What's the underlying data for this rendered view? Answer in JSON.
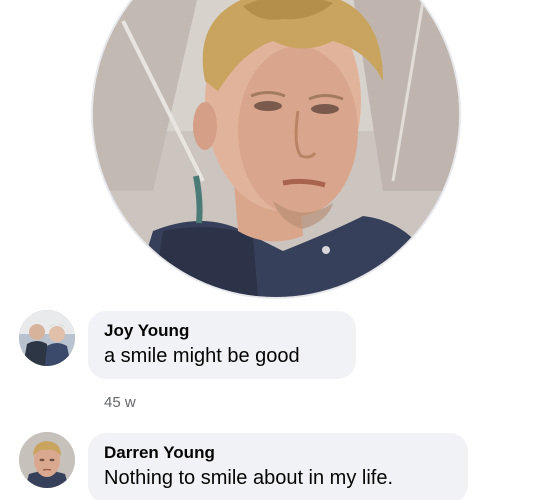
{
  "profile": {
    "photo_icon": "profile-photo"
  },
  "comments": [
    {
      "author": "Joy Young",
      "text": "a smile might be good",
      "timestamp": "45 w",
      "avatar_icon": "avatar-photo"
    },
    {
      "author": "Darren Young",
      "text": "Nothing to smile about in my life.",
      "avatar_icon": "avatar-photo"
    }
  ],
  "colors": {
    "bubble_bg": "#f0f2f5",
    "text": "#050505",
    "meta_text": "#65676b"
  }
}
